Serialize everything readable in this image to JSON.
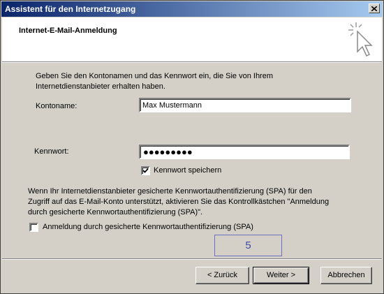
{
  "window": {
    "title": "Assistent für den Internetzugang"
  },
  "header": {
    "title": "Internet-E-Mail-Anmeldung"
  },
  "intro_text": "Geben Sie den Kontonamen und das Kennwort ein, die Sie von Ihrem Internetdienstanbieter erhalten haben.",
  "account": {
    "label": "Kontoname:",
    "value": "Max Mustermann"
  },
  "password": {
    "label": "Kennwort:",
    "masked_value": "●●●●●●●●●"
  },
  "remember_password": {
    "label": "Kennwort speichern",
    "checked": true
  },
  "spa": {
    "description": "Wenn Ihr Internetdienstanbieter gesicherte Kennwortauthentifizierung (SPA) für den Zugriff auf das E-Mail-Konto unterstützt, aktivieren Sie das Kontrollkästchen \"Anmeldung durch gesicherte Kennwortauthentifizierung (SPA)\".",
    "checkbox_label": "Anmeldung durch gesicherte Kennwortauthentifizierung (SPA)",
    "checked": false
  },
  "page_indicator": "5",
  "buttons": {
    "back": "< Zurück",
    "next": "Weiter >",
    "cancel": "Abbrechen"
  },
  "icons": {
    "close": "close-icon",
    "wizard": "wizard-cursor-icon",
    "check": "checkmark-icon"
  },
  "colors": {
    "title_start": "#0a246a",
    "title_end": "#a6caf0",
    "face": "#d4d0c8",
    "page_box": "#3a4aa8"
  }
}
